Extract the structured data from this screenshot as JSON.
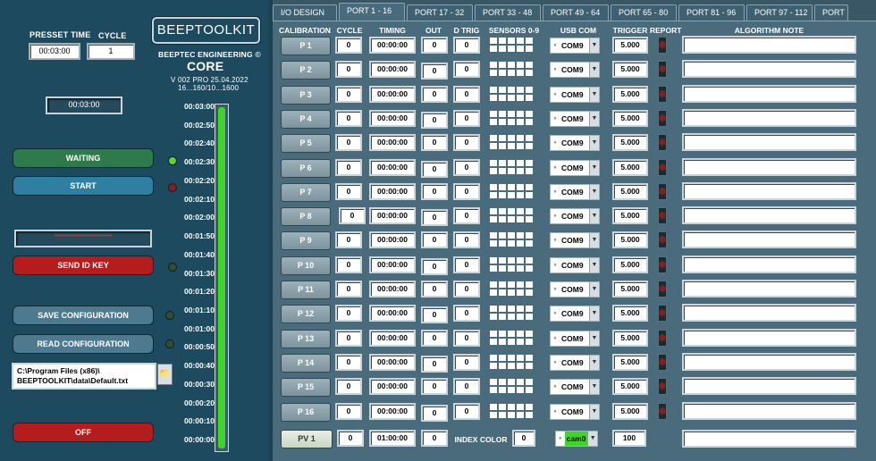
{
  "left": {
    "preset_time_label": "PRESSET TIME",
    "cycle_label": "CYCLE",
    "preset_time_value": "00:03:00",
    "cycle_value": "1",
    "logo_text": "BEEPTOOLKIT",
    "company": "BEEPTEC ENGINEERING ©",
    "product": "CORE",
    "version": "V 002 PRO 25.04.2022",
    "range": "16...160/10...1600",
    "countdown": "00:03:00",
    "waiting_label": "WAITING",
    "start_label": "START",
    "id_key_mask": "*****************************",
    "send_id_key_label": "SEND ID KEY",
    "save_config_label": "SAVE  CONFIGURATION",
    "read_config_label": "READ CONFIGURATION",
    "config_path": "C:\\Program Files (x86)\\ BEEPTOOLKIT\\data\\Default.txt",
    "off_label": "OFF",
    "led_colors": {
      "waiting": "#5fd330",
      "start": "#8b1d1d",
      "send": "#3a4a2a",
      "save": "#3a4a2a",
      "read": "#3a4a2a"
    },
    "timeline_ticks": [
      "00:03:00",
      "00:02:50",
      "00:02:40",
      "00:02:30",
      "00:02:20",
      "00:02:10",
      "00:02:00",
      "00:01:50",
      "00:01:40",
      "00:01:30",
      "00:01:20",
      "00:01:10",
      "00:01:00",
      "00:00:50",
      "00:00:40",
      "00:00:30",
      "00:00:20",
      "00:00:10",
      "00:00:00"
    ],
    "timeline_fill_fraction": 1.0
  },
  "tabs": [
    "I/O DESIGN",
    "PORT 1 - 16",
    "PORT 17 - 32",
    "PORT 33 - 48",
    "PORT 49 - 64",
    "PORT 65 - 80",
    "PORT 81 - 96",
    "PORT 97 - 112",
    "PORT"
  ],
  "active_tab": "PORT 1 - 16",
  "headers": {
    "calibration": "CALIBRATION",
    "cycle": "CYCLE",
    "timing": "TIMING",
    "out": "OUT",
    "dtrig": "D TRIG",
    "sensors": "SENSORS 0-9",
    "usbcom": "USB COM",
    "trigger": "TRIGGER",
    "report": "REPORT",
    "note": "ALGORITHM NOTE"
  },
  "rows": [
    {
      "label": "P 1",
      "cycle": "0",
      "timing": "00:00:00",
      "out": "0",
      "dtrig": "0",
      "com": "COM9",
      "trigger": "5.000"
    },
    {
      "label": "P 2",
      "cycle": "0",
      "timing": "00:00:00",
      "out": "0",
      "dtrig": "0",
      "com": "COM9",
      "trigger": "5.000"
    },
    {
      "label": "P 3",
      "cycle": "0",
      "timing": "00:00:00",
      "out": "0",
      "dtrig": "0",
      "com": "COM9",
      "trigger": "5.000"
    },
    {
      "label": "P 4",
      "cycle": "0",
      "timing": "00:00:00",
      "out": "0",
      "dtrig": "0",
      "com": "COM9",
      "trigger": "5.000"
    },
    {
      "label": "P 5",
      "cycle": "0",
      "timing": "00:00:00",
      "out": "0",
      "dtrig": "0",
      "com": "COM9",
      "trigger": "5.000"
    },
    {
      "label": "P 6",
      "cycle": "0",
      "timing": "00:00:00",
      "out": "0",
      "dtrig": "0",
      "com": "COM9",
      "trigger": "5.000"
    },
    {
      "label": "P 7",
      "cycle": "0",
      "timing": "00:00:00",
      "out": "0",
      "dtrig": "0",
      "com": "COM9",
      "trigger": "5.000"
    },
    {
      "label": "P 8",
      "cycle": "0",
      "timing": "00:00:00",
      "out": "0",
      "dtrig": "0",
      "com": "COM9",
      "trigger": "5.000"
    },
    {
      "label": "P 9",
      "cycle": "0",
      "timing": "00:00:00",
      "out": "0",
      "dtrig": "0",
      "com": "COM9",
      "trigger": "5.000"
    },
    {
      "label": "P 10",
      "cycle": "0",
      "timing": "00:00:00",
      "out": "0",
      "dtrig": "0",
      "com": "COM9",
      "trigger": "5.000"
    },
    {
      "label": "P 11",
      "cycle": "0",
      "timing": "00:00:00",
      "out": "0",
      "dtrig": "0",
      "com": "COM9",
      "trigger": "5.000"
    },
    {
      "label": "P 12",
      "cycle": "0",
      "timing": "00:00:00",
      "out": "0",
      "dtrig": "0",
      "com": "COM9",
      "trigger": "5.000"
    },
    {
      "label": "P 13",
      "cycle": "0",
      "timing": "00:00:00",
      "out": "0",
      "dtrig": "0",
      "com": "COM9",
      "trigger": "5.000"
    },
    {
      "label": "P 14",
      "cycle": "0",
      "timing": "00:00:00",
      "out": "0",
      "dtrig": "0",
      "com": "COM9",
      "trigger": "5.000"
    },
    {
      "label": "P 15",
      "cycle": "0",
      "timing": "00:00:00",
      "out": "0",
      "dtrig": "0",
      "com": "COM9",
      "trigger": "5.000"
    },
    {
      "label": "P 16",
      "cycle": "0",
      "timing": "00:00:00",
      "out": "0",
      "dtrig": "0",
      "com": "COM9",
      "trigger": "5.000"
    }
  ],
  "pv": {
    "label": "PV 1",
    "cycle": "0",
    "timing": "01:00:00",
    "out": "0",
    "index_color_label": "INDEX  COLOR",
    "index_color_value": "0",
    "cam": "cam0",
    "trigger": "100"
  },
  "colors": {
    "accent_green": "#3fd42a",
    "report_led": "#8b1d1d"
  }
}
